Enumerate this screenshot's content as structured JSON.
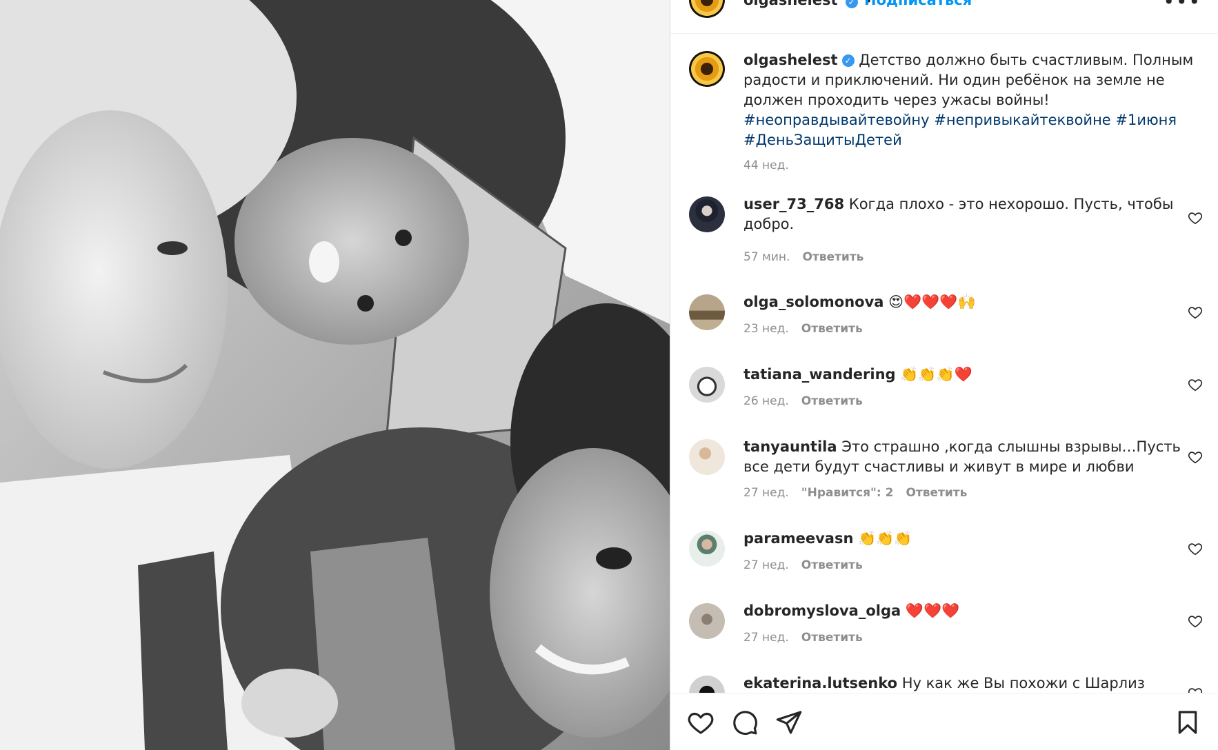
{
  "post": {
    "author": "olgashelest",
    "follow_label": "Подписаться",
    "more_label": "•••",
    "caption_text": "Детство должно быть счастливым. Полным радости и приключений. Ни один ребёнок на земле не должен проходить через ужасы войны!",
    "hashtags_line1": "#неоправдывайтевойну #непривыкайтеквойне #1июня",
    "hashtags_line2": "#ДеньЗащитыДетей",
    "time": "44 нед."
  },
  "reply_label": "Ответить",
  "comments": [
    {
      "user": "user_73_768",
      "text": "Когда плохо - это нехорошо. Пусть, чтобы добро.",
      "time": "57 мин."
    },
    {
      "user": "olga_solomonova",
      "text": "😍❤️❤️❤️🙌",
      "time": "23 нед."
    },
    {
      "user": "tatiana_wandering",
      "text": "👏👏👏❤️",
      "time": "26 нед."
    },
    {
      "user": "tanyauntila",
      "text": "Это страшно ,когда слышны взрывы…Пусть все дети будут счастливы и живут в мире и любви",
      "time": "27 нед.",
      "likes": "\"Нравится\": 2"
    },
    {
      "user": "parameevasn",
      "text": "👏👏👏",
      "time": "27 нед."
    },
    {
      "user": "dobromyslova_olga",
      "text": "❤️❤️❤️",
      "time": "27 нед."
    },
    {
      "user": "ekaterina.lutsenko",
      "text": "Ну как же Вы похожи с Шарлиз Терон!"
    }
  ],
  "colors": {
    "link_blue": "#0095f6",
    "hashtag": "#00376b",
    "verified": "#3897f0",
    "secondary_text": "#8e8e8e"
  },
  "icons": [
    "heart-icon",
    "comment-icon",
    "share-icon",
    "bookmark-icon",
    "verified-icon",
    "more-icon"
  ]
}
